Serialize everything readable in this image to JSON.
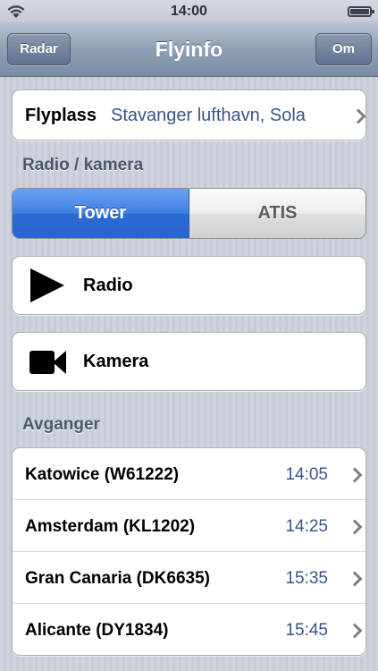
{
  "status_bar": {
    "time": "14:00"
  },
  "nav": {
    "title": "Flyinfo",
    "left_button": "Radar",
    "right_button": "Om"
  },
  "airport": {
    "label": "Flyplass",
    "value": "Stavanger lufthavn, Sola"
  },
  "radio_section": {
    "header": "Radio / kamera",
    "segments": [
      {
        "label": "Tower",
        "selected": true
      },
      {
        "label": "ATIS",
        "selected": false
      }
    ],
    "radio_label": "Radio",
    "camera_label": "Kamera"
  },
  "departures": {
    "header": "Avganger",
    "rows": [
      {
        "flight": "Katowice (W61222)",
        "time": "14:05"
      },
      {
        "flight": "Amsterdam (KL1202)",
        "time": "14:25"
      },
      {
        "flight": "Gran Canaria (DK6635)",
        "time": "15:35"
      },
      {
        "flight": "Alicante (DY1834)",
        "time": "15:45"
      }
    ]
  },
  "colors": {
    "accent_blue": "#3f7fe3",
    "value_text": "#385487",
    "nav_bar": "#8f9fb5"
  },
  "icons": [
    "wifi-icon",
    "battery-icon",
    "chevron-right-icon",
    "play-icon",
    "video-camera-icon"
  ]
}
